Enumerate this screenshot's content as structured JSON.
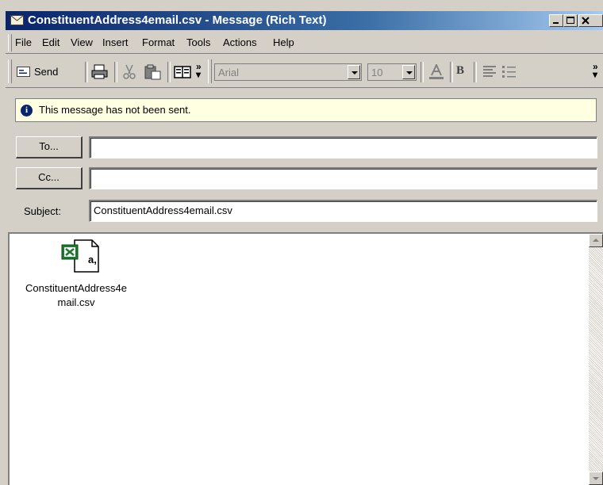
{
  "window": {
    "title": "ConstituentAddress4email.csv - Message (Rich Text)"
  },
  "menu": [
    "File",
    "Edit",
    "View",
    "Insert",
    "Format",
    "Tools",
    "Actions",
    "Help"
  ],
  "toolbar": {
    "send_label": "Send",
    "font_name": "Arial",
    "font_size": "10",
    "bold_label": "B"
  },
  "infobar": {
    "message": "This message has not been sent.",
    "icon_glyph": "i"
  },
  "fields": {
    "to_button": "To...",
    "to_value": "",
    "cc_button": "Cc...",
    "cc_value": "",
    "subject_label": "Subject:",
    "subject_value": "ConstituentAddress4email.csv"
  },
  "attachment": {
    "name_line1": "ConstituentAddress4e",
    "name_line2": "mail.csv",
    "icon_text": "a,"
  },
  "colors": {
    "titlebar_start": "#0a246a",
    "titlebar_end": "#a6caf0",
    "chrome": "#d4d0c8",
    "infobar_bg": "#ffffe1",
    "excel_green": "#1e7a2e"
  },
  "icons": {
    "title": "envelope-icon",
    "send": "send-form-icon",
    "print": "print-icon",
    "cut": "cut-icon",
    "paste": "paste-icon",
    "address_book": "address-book-icon",
    "font_color": "font-color-icon",
    "align": "align-left-icon",
    "bullets": "bullets-icon"
  }
}
